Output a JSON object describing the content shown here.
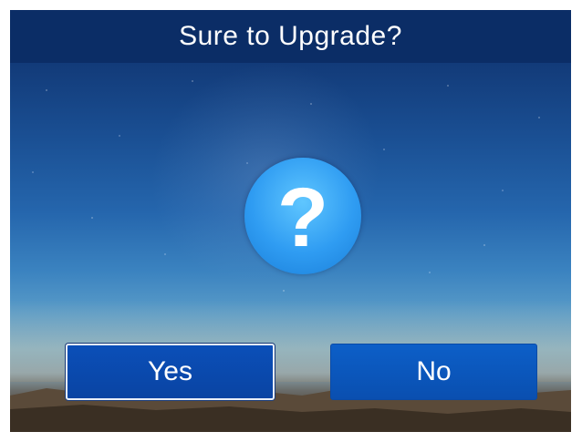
{
  "dialog": {
    "title": "Sure to Upgrade?",
    "icon": "question-mark-icon",
    "icon_glyph": "?",
    "yes_label": "Yes",
    "no_label": "No",
    "selected_button": "yes"
  },
  "colors": {
    "title_bar": "#0b2d66",
    "button_selected": "#0b4fb8",
    "button_default": "#0c5fc8",
    "icon_circle": "#2f9cf2",
    "text": "#ffffff"
  }
}
